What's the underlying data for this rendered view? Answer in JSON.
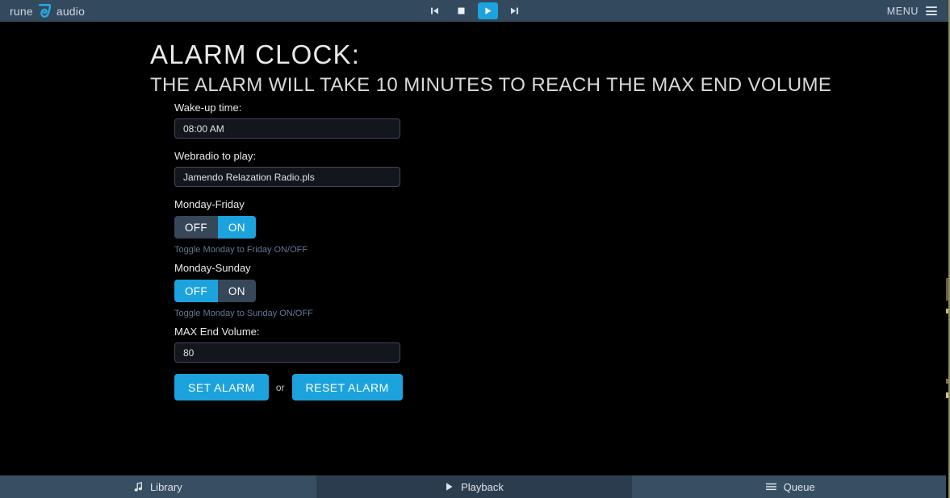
{
  "brand": {
    "left_word": "rune",
    "right_word": "audio",
    "logo_icon": "runeaudio-mask-icon"
  },
  "player": {
    "previous_label": "previous-track",
    "stop_label": "stop",
    "play_label": "play",
    "next_label": "next-track",
    "active_control": "play",
    "accent_color": "#1ca3dd"
  },
  "menu": {
    "label": "MENU",
    "icon": "hamburger-icon"
  },
  "page": {
    "title": "ALARM CLOCK:",
    "subtitle": "THE ALARM WILL TAKE 10 MINUTES TO REACH THE MAX END VOLUME"
  },
  "form": {
    "wake_time": {
      "label": "Wake-up time:",
      "value": "08:00 AM",
      "placeholder": "08:00 AM"
    },
    "webradio": {
      "label": "Webradio to play:",
      "value": "Jamendo Relazation Radio.pls",
      "placeholder": "Webradio to play"
    },
    "monday_friday": {
      "label": "Monday-Friday",
      "off_label": "OFF",
      "on_label": "ON",
      "active": "ON",
      "help": "Toggle Monday to Friday ON/OFF"
    },
    "monday_sunday": {
      "label": "Monday-Sunday",
      "off_label": "OFF",
      "on_label": "ON",
      "active": "OFF",
      "help": "Toggle Monday to Sunday ON/OFF"
    },
    "max_volume": {
      "label": "MAX End Volume:",
      "value": "80",
      "placeholder": "80"
    },
    "set_alarm_label": "SET ALARM",
    "or_label": "or",
    "reset_alarm_label": "RESET ALARM"
  },
  "bottom_nav": {
    "tabs": [
      {
        "label": "Library",
        "icon": "music-note-icon",
        "active": true
      },
      {
        "label": "Playback",
        "icon": "play-triangle-icon",
        "active": false
      },
      {
        "label": "Queue",
        "icon": "list-lines-icon",
        "active": true
      }
    ]
  },
  "colors": {
    "accent": "#1ca3dd",
    "topbar": "#33495e",
    "bottombar": "#374e63",
    "bottombar_dim": "#2b3c4e",
    "inactive_segment": "#37475a",
    "background": "#000000",
    "input_bg": "#13171d",
    "help_text": "#5f7a95",
    "edge_sliver": "#8d8f5a"
  }
}
